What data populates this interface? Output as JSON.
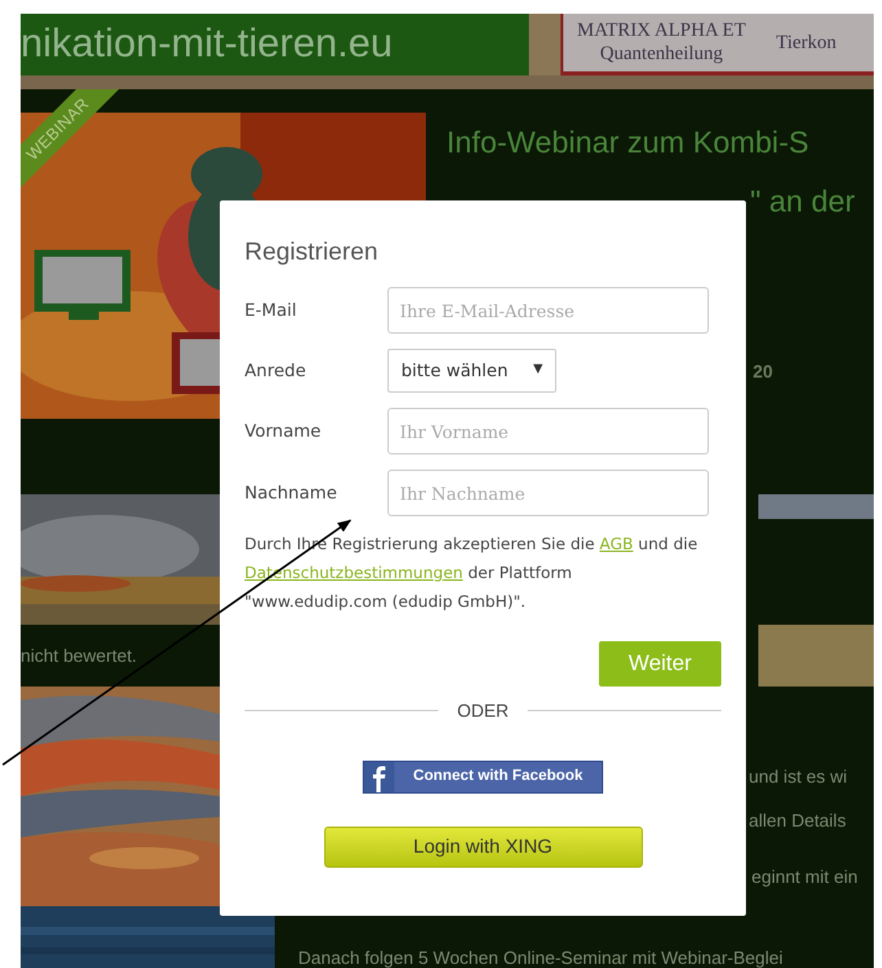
{
  "header": {
    "site_title": "nikation-mit-tieren.eu",
    "nav": [
      {
        "title": "MATRIX ALPHA ET",
        "subtitle": "Quantenheilung"
      },
      {
        "title": "Tierkon"
      }
    ]
  },
  "hero": {
    "ribbon": "WEBINAR",
    "title": "Info-Webinar zum Kombi-S",
    "title_fragment": "\" an der",
    "date_fragment": "20"
  },
  "rating": "nicht bewertet.",
  "description_fragments": [
    "und ist es wi",
    "allen Details",
    "eginnt mit ein"
  ],
  "description_line": "Danach folgen 5 Wochen Online-Seminar mit Webinar-Beglei",
  "dialog": {
    "title": "Registrieren",
    "fields": [
      {
        "kind": "text",
        "label": "E-Mail",
        "placeholder": "Ihre E-Mail-Adresse"
      },
      {
        "kind": "select",
        "label": "Anrede",
        "value": "bitte wählen",
        "caret": "▼"
      },
      {
        "kind": "text",
        "label": "Vorname",
        "placeholder": "Ihr Vorname"
      },
      {
        "kind": "text",
        "label": "Nachname",
        "placeholder": "Ihr Nachname"
      }
    ],
    "consent": [
      {
        "kind": "text",
        "text": "Durch Ihre Registrierung akzeptieren Sie die "
      },
      {
        "kind": "link",
        "text": "AGB"
      },
      {
        "kind": "text",
        "text": " und die "
      },
      {
        "kind": "link",
        "text": "Datenschutzbestimmungen"
      },
      {
        "kind": "text",
        "text": " der Plattform \"www.edudip.com (edudip GmbH)\"."
      }
    ],
    "submit": "Weiter",
    "divider": "ODER",
    "facebook": "Connect with Facebook",
    "xing": "Login with XING"
  }
}
